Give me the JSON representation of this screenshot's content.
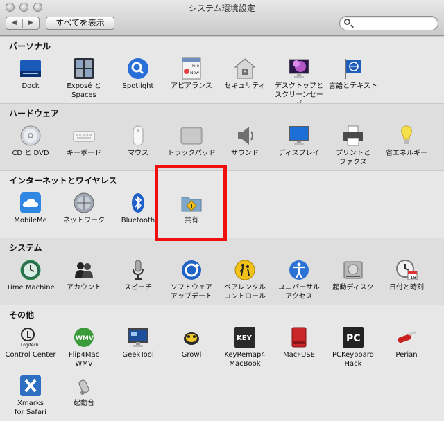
{
  "window": {
    "title": "システム環境設定"
  },
  "toolbar": {
    "back": "◀",
    "forward": "▶",
    "show_all": "すべてを表示",
    "search_value": ""
  },
  "colors": {
    "highlight": "#f00f0f"
  },
  "sections": {
    "personal": {
      "title": "パーソナル",
      "items": [
        {
          "label": "Dock",
          "icon": "dock-icon"
        },
        {
          "label": "Exposé と\nSpaces",
          "icon": "expose-icon"
        },
        {
          "label": "Spotlight",
          "icon": "spotlight-icon"
        },
        {
          "label": "アピアランス",
          "icon": "appearance-icon"
        },
        {
          "label": "セキュリティ",
          "icon": "security-icon"
        },
        {
          "label": "デスクトップと\nスクリーンセーバ",
          "icon": "desktop-icon"
        },
        {
          "label": "言語とテキスト",
          "icon": "language-icon"
        }
      ]
    },
    "hardware": {
      "title": "ハードウェア",
      "items": [
        {
          "label": "CD と DVD",
          "icon": "cd-icon"
        },
        {
          "label": "キーボード",
          "icon": "keyboard-icon"
        },
        {
          "label": "マウス",
          "icon": "mouse-icon"
        },
        {
          "label": "トラックパッド",
          "icon": "trackpad-icon"
        },
        {
          "label": "サウンド",
          "icon": "sound-icon"
        },
        {
          "label": "ディスプレイ",
          "icon": "display-icon"
        },
        {
          "label": "プリントと\nファクス",
          "icon": "printer-icon"
        },
        {
          "label": "省エネルギー",
          "icon": "bulb-icon"
        }
      ]
    },
    "internet": {
      "title": "インターネットとワイヤレス",
      "items": [
        {
          "label": "MobileMe",
          "icon": "cloud-icon"
        },
        {
          "label": "ネットワーク",
          "icon": "network-icon"
        },
        {
          "label": "Bluetooth",
          "icon": "bluetooth-icon"
        },
        {
          "label": "共有",
          "icon": "sharing-folder-icon"
        }
      ]
    },
    "system": {
      "title": "システム",
      "items": [
        {
          "label": "Time Machine",
          "icon": "time-machine-icon"
        },
        {
          "label": "アカウント",
          "icon": "accounts-icon"
        },
        {
          "label": "スピーチ",
          "icon": "microphone-icon"
        },
        {
          "label": "ソフトウェア\nアップデート",
          "icon": "software-update-icon"
        },
        {
          "label": "ペアレンタル\nコントロール",
          "icon": "parental-icon"
        },
        {
          "label": "ユニバーサル\nアクセス",
          "icon": "universal-access-icon"
        },
        {
          "label": "起動ディスク",
          "icon": "disk-icon"
        },
        {
          "label": "日付と時刻",
          "icon": "clock-icon"
        }
      ]
    },
    "other": {
      "title": "その他",
      "items": [
        {
          "label": "Control Center",
          "icon": "logitech-icon"
        },
        {
          "label": "Flip4Mac\nWMV",
          "icon": "wmv-icon"
        },
        {
          "label": "GeekTool",
          "icon": "geektool-icon"
        },
        {
          "label": "Growl",
          "icon": "growl-icon"
        },
        {
          "label": "KeyRemap4\nMacBook",
          "icon": "key-icon"
        },
        {
          "label": "MacFUSE",
          "icon": "macfuse-icon"
        },
        {
          "label": "PCKeyboard\nHack",
          "icon": "pc-icon"
        },
        {
          "label": "Perian",
          "icon": "knife-icon"
        },
        {
          "label": "Xmarks\nfor Safari",
          "icon": "xmarks-icon"
        },
        {
          "label": "起動音",
          "icon": "whistle-icon"
        }
      ]
    }
  },
  "icon_text": {
    "key": "KEY",
    "pc": "PC",
    "wmv": "WMV",
    "logitech": "Logitech",
    "calendar_day": "18",
    "new": "New",
    "file": "File"
  }
}
